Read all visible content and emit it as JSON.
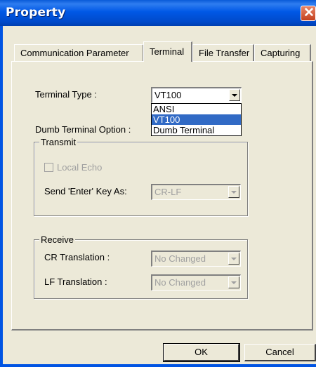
{
  "window": {
    "title": "Property"
  },
  "tabs": [
    {
      "label": "Communication Parameter"
    },
    {
      "label": "Terminal"
    },
    {
      "label": "File Transfer"
    },
    {
      "label": "Capturing"
    }
  ],
  "terminal": {
    "type_label": "Terminal Type :",
    "type_value": "VT100",
    "type_options": [
      "ANSI",
      "VT100",
      "Dumb Terminal"
    ],
    "dumb_label": "Dumb Terminal Option :",
    "transmit": {
      "legend": "Transmit",
      "local_echo_label": "Local Echo",
      "enter_key_label": "Send 'Enter' Key  As:",
      "enter_key_value": "CR-LF"
    },
    "receive": {
      "legend": "Receive",
      "cr_label": "CR Translation :",
      "cr_value": "No Changed",
      "lf_label": "LF Translation :",
      "lf_value": "No Changed"
    }
  },
  "buttons": {
    "ok": "OK",
    "cancel": "Cancel"
  }
}
